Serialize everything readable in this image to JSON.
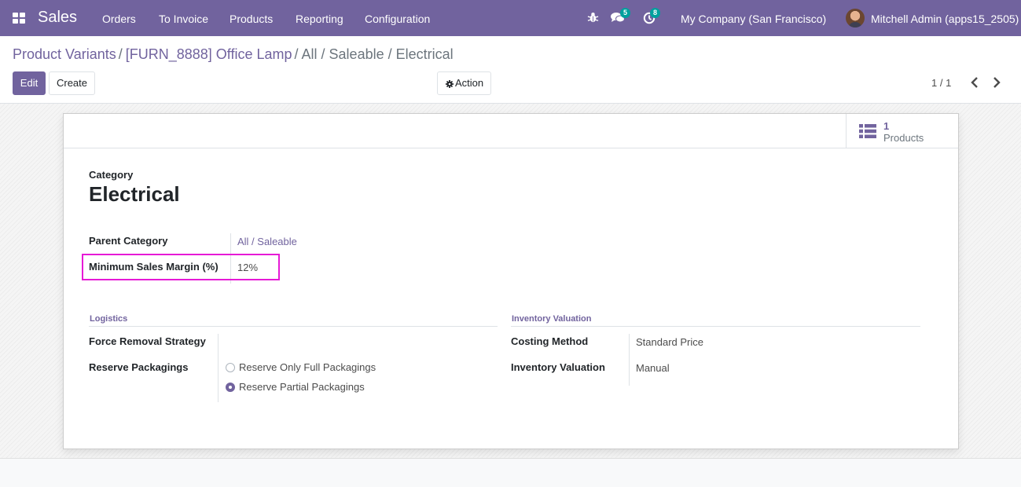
{
  "navbar": {
    "app_name": "Sales",
    "menu": [
      "Orders",
      "To Invoice",
      "Products",
      "Reporting",
      "Configuration"
    ],
    "chat_count": "5",
    "activity_count": "8",
    "company": "My Company (San Francisco)",
    "user": "Mitchell Admin (apps15_2505)",
    "icons": [
      "apps-grid-icon",
      "bug-icon",
      "chat-icon",
      "clock-icon"
    ]
  },
  "breadcrumb": {
    "items": [
      "Product Variants",
      "[FURN_8888] Office Lamp"
    ],
    "separator": "/",
    "active": "All / Saleable / Electrical"
  },
  "toolbar": {
    "edit_label": "Edit",
    "create_label": "Create",
    "action_label": "Action",
    "pager": "1 / 1"
  },
  "smart_button": {
    "value": "1",
    "label": "Products",
    "icon": "list-icon"
  },
  "record": {
    "caption": "Category",
    "name": "Electrical",
    "fields": [
      {
        "label": "Parent Category",
        "value": "All / Saleable"
      },
      {
        "label": "Minimum Sales Margin (%)",
        "value": "12%"
      }
    ]
  },
  "logistics": {
    "title": "Logistics",
    "force_removal_label": "Force Removal Strategy",
    "force_removal_value": "",
    "reserve_label": "Reserve Packagings",
    "options": [
      "Reserve Only Full Packagings",
      "Reserve Partial Packagings"
    ],
    "selected_option": "Reserve Partial Packagings"
  },
  "valuation": {
    "title": "Inventory Valuation",
    "fields": [
      {
        "label": "Costing Method",
        "value": "Standard Price"
      },
      {
        "label": "Inventory Valuation",
        "value": "Manual"
      }
    ]
  },
  "colors": {
    "brand": "#71639e",
    "badge": "#00a09d",
    "highlight": "#e61ad6"
  }
}
